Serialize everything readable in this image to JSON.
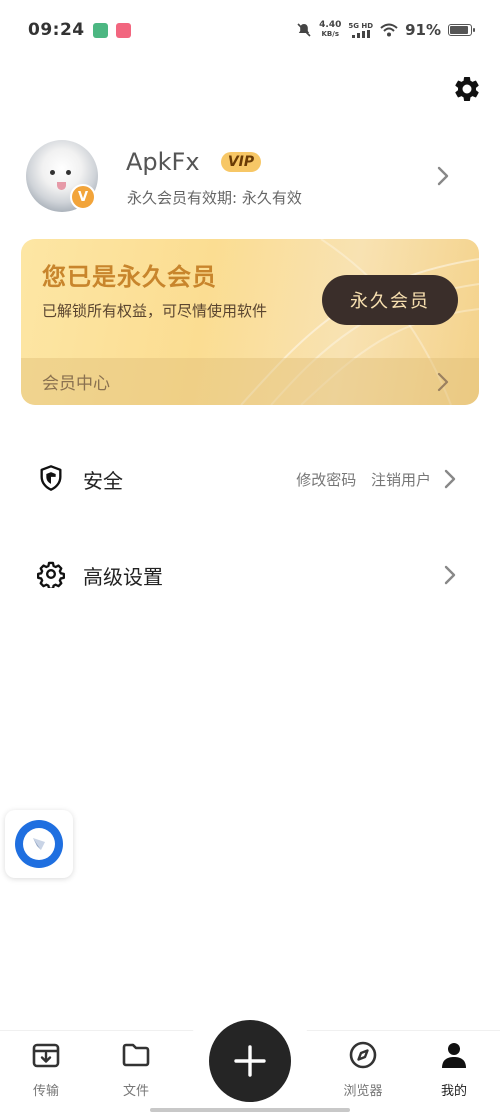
{
  "status_bar": {
    "time": "09:24",
    "net_speed_value": "4.40",
    "net_speed_unit": "KB/s",
    "signal_label": "5G HD",
    "battery_percent": "91%",
    "battery_level": 0.91
  },
  "profile": {
    "username": "ApkFx",
    "vip_tag": "VIP",
    "badge_letter": "V",
    "expiry_text": "永久会员有效期: 永久有效"
  },
  "vip_card": {
    "title": "您已是永久会员",
    "description": "已解锁所有权益，可尽情使用软件",
    "button_label": "永久会员",
    "footer_label": "会员中心"
  },
  "menu": {
    "security": {
      "label": "安全",
      "actions": [
        "修改密码",
        "注销用户"
      ]
    },
    "advanced": {
      "label": "高级设置"
    }
  },
  "bottom_nav": {
    "items": [
      {
        "label": "传输",
        "icon": "transfer-icon"
      },
      {
        "label": "文件",
        "icon": "folder-icon"
      },
      {
        "label": "浏览器",
        "icon": "compass-icon"
      },
      {
        "label": "我的",
        "icon": "user-icon"
      }
    ],
    "active": "我的"
  },
  "colors": {
    "vip_gold": "#c8852c",
    "vip_button_bg": "#3a2e2a",
    "widget_blue": "#1f6fe0"
  }
}
